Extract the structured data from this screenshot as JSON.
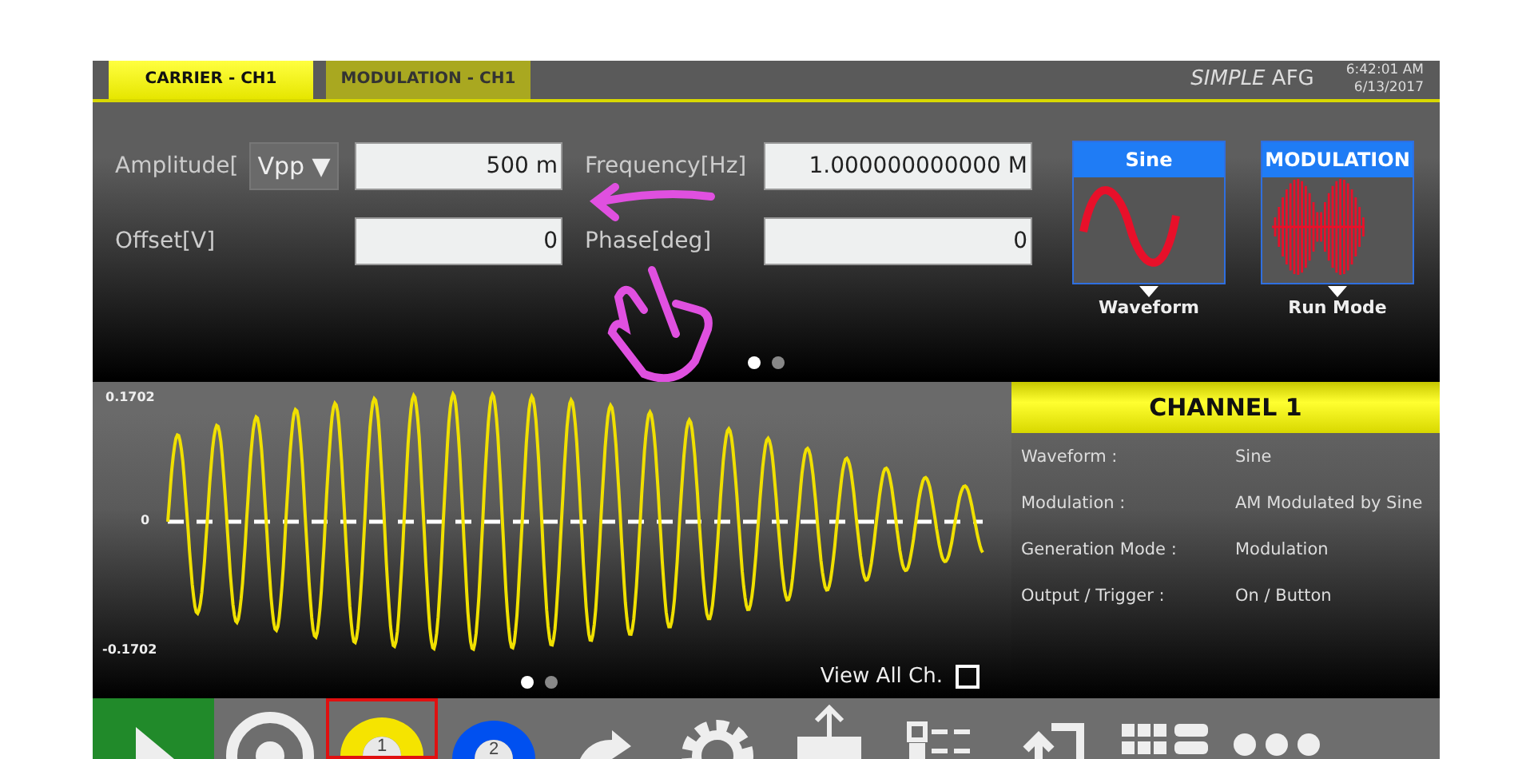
{
  "tabs": [
    {
      "label": "CARRIER - CH1",
      "selected": true
    },
    {
      "label": "MODULATION - CH1",
      "selected": false
    }
  ],
  "app_title": {
    "italic": "SIMPLE",
    "rest": "AFG"
  },
  "clock": {
    "time": "6:42:01 AM",
    "date": "6/13/2017"
  },
  "fields": [
    {
      "label": "Amplitude[",
      "unit": "Vpp ▼",
      "value": "500 m"
    },
    {
      "label": "Frequency[Hz]",
      "value": "1.000000000000 M"
    },
    {
      "label": "Offset[V]",
      "value": "0"
    },
    {
      "label": "Phase[deg]",
      "value": "0"
    }
  ],
  "tiles": [
    {
      "title": "Sine",
      "kind": "sine",
      "caption": "Waveform"
    },
    {
      "title": "MODULATION",
      "kind": "burst",
      "caption": "Run Mode"
    }
  ],
  "top_pages": [
    {
      "selected": true
    },
    {
      "selected": false
    }
  ],
  "chart": {
    "ticks": [
      "0.1702",
      "0",
      "-0.1702"
    ]
  },
  "chart_pages": [
    {
      "selected": true
    },
    {
      "selected": false
    }
  ],
  "view_all": {
    "label": "View All Ch.",
    "checked": false
  },
  "channel": {
    "title": "CHANNEL 1",
    "rows": [
      {
        "key": "Waveform :",
        "value": "Sine"
      },
      {
        "key": "Modulation :",
        "value": "AM Modulated by Sine"
      },
      {
        "key": "Generation Mode :",
        "value": "Modulation"
      },
      {
        "key": "Output / Trigger :",
        "value": "On / Button"
      }
    ]
  },
  "toolbar": [
    {
      "kind": "play",
      "selected": false
    },
    {
      "kind": "record",
      "selected": false
    },
    {
      "kind": "channel",
      "number": "1",
      "color": "#f5e400",
      "selected": true
    },
    {
      "kind": "channel",
      "number": "2",
      "color": "#0050f0",
      "selected": false
    },
    {
      "kind": "redo",
      "selected": false
    },
    {
      "kind": "gear",
      "selected": false
    },
    {
      "kind": "upload",
      "selected": false
    },
    {
      "kind": "list",
      "selected": false
    },
    {
      "kind": "return",
      "selected": false
    },
    {
      "kind": "grid",
      "selected": false
    },
    {
      "kind": "more",
      "selected": false
    }
  ]
}
